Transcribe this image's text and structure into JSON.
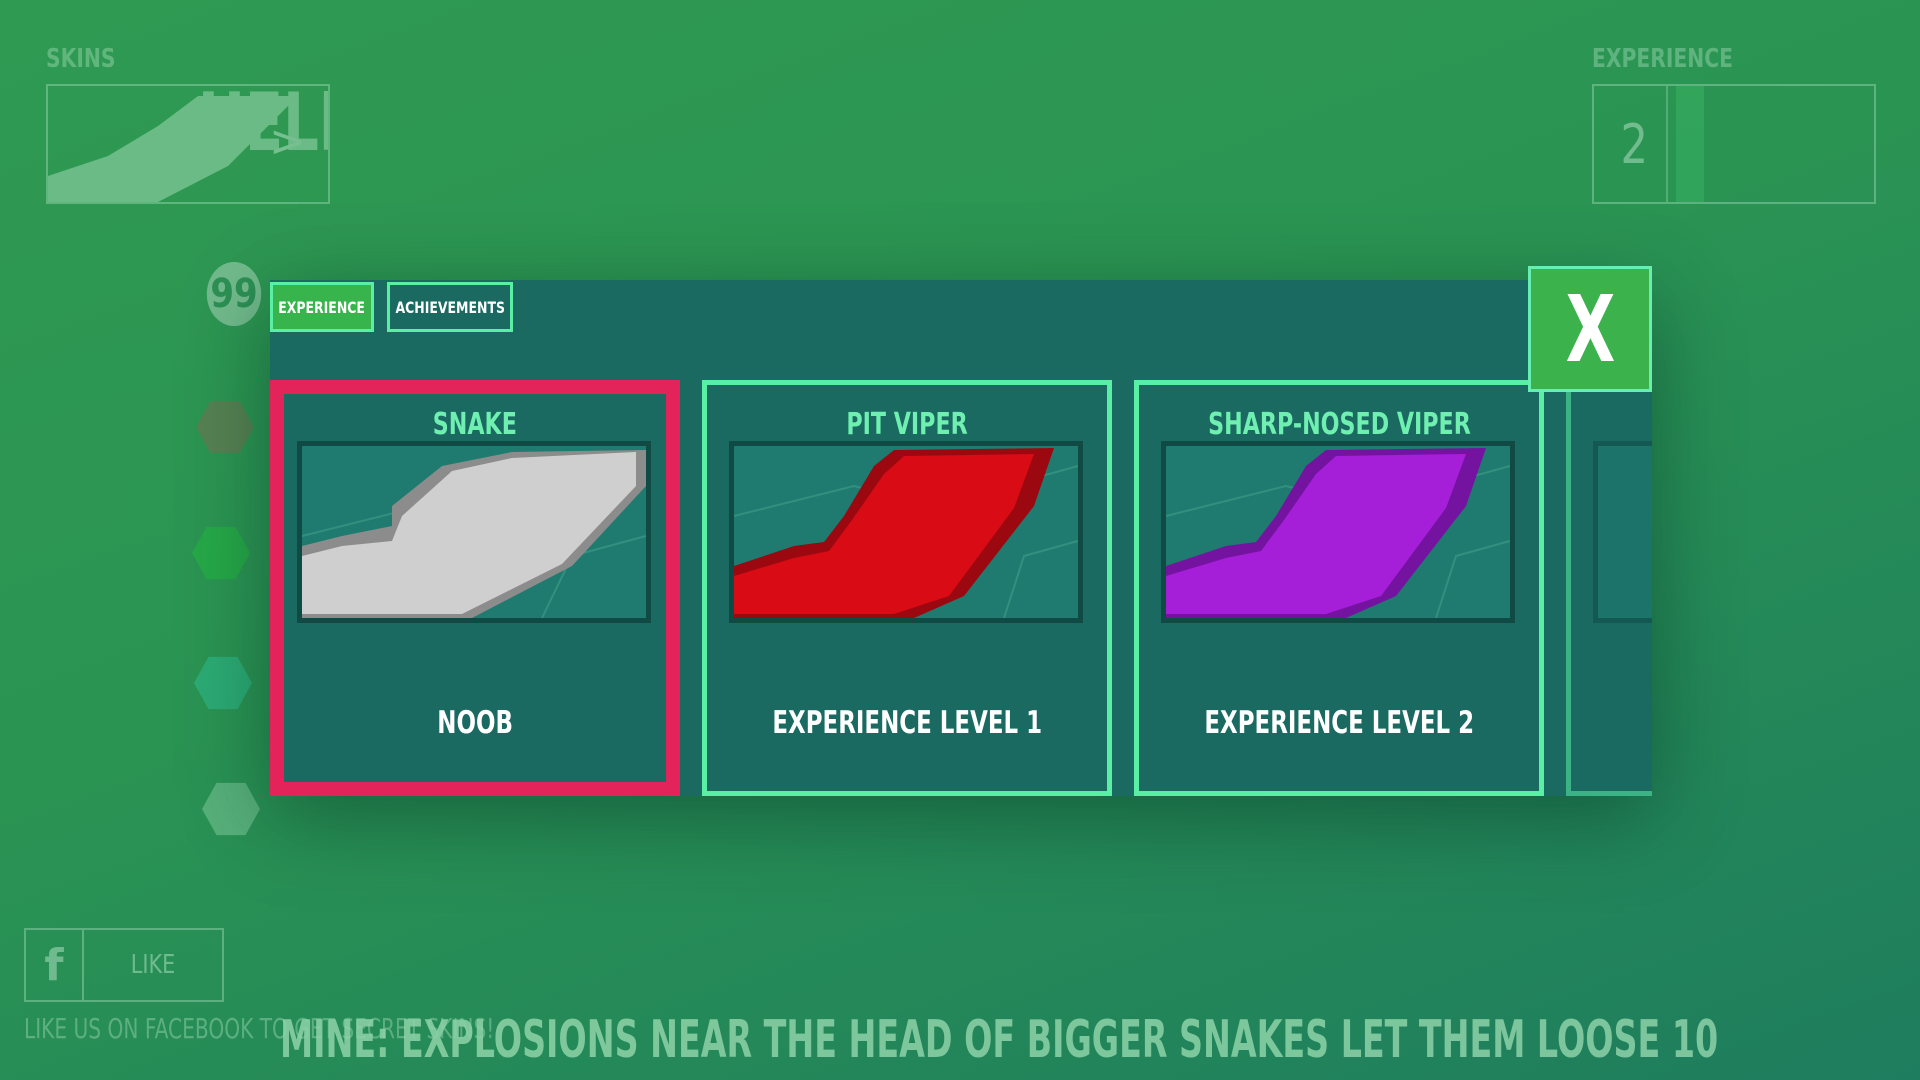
{
  "hud": {
    "skins_label": "SKINS",
    "help_text": "HELP",
    "help_arrow": ">",
    "experience_label": "EXPERIENCE",
    "experience_level": "2",
    "rank_badge": "99",
    "facebook_icon": "f",
    "like_label": "LIKE",
    "facebook_hint": "LIKE US ON FACEBOOK TO GET SECRET SKINS!",
    "tip_text": "MINE: EXPLOSIONS NEAR THE HEAD OF BIGGER SNAKES LET THEM LOOSE 10"
  },
  "modal": {
    "tabs": [
      {
        "label": "EXPERIENCE",
        "active": true
      },
      {
        "label": "ACHIEVEMENTS",
        "active": false
      }
    ],
    "close_label": "X",
    "skins": [
      {
        "name": "SNAKE",
        "requirement": "NOOB",
        "selected": true,
        "color": "#c9c9c9",
        "shade": "#8c8c8c"
      },
      {
        "name": "PIT VIPER",
        "requirement": "EXPERIENCE LEVEL 1",
        "selected": false,
        "color": "#d90b14",
        "shade": "#9c0810"
      },
      {
        "name": "SHARP-NOSED VIPER",
        "requirement": "EXPERIENCE LEVEL 2",
        "selected": false,
        "color": "#a51fd8",
        "shade": "#7513a1"
      }
    ]
  },
  "colors": {
    "accent": "#59f0a6",
    "selected_border": "#e2245a",
    "panel": "#1a6a62",
    "button": "#3cb24c"
  }
}
